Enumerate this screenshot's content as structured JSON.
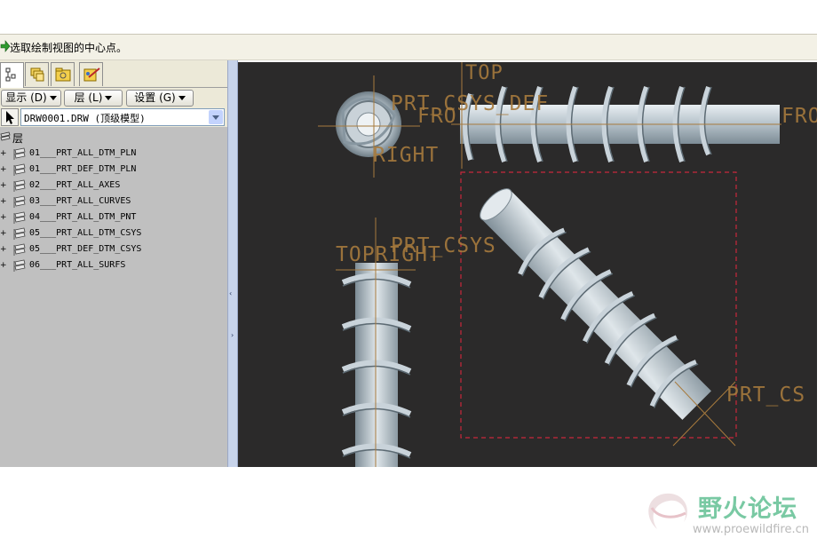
{
  "message_bar": {
    "text": "选取绘制视图的中心点。"
  },
  "left_panel": {
    "tabs": [
      "model-tree-tab",
      "layers-tab",
      "folder-tab",
      "favorites-tab"
    ],
    "menu": {
      "show_label": "显示 (D)",
      "layer_label": "层 (L)",
      "settings_label": "设置 (G)"
    },
    "selector_value": "DRW0001.DRW (顶级模型)",
    "tree_root_label": "层",
    "layers": [
      "01___PRT_ALL_DTM_PLN",
      "01___PRT_DEF_DTM_PLN",
      "02___PRT_ALL_AXES",
      "03___PRT_ALL_CURVES",
      "04___PRT_ALL_DTM_PNT",
      "05___PRT_ALL_DTM_CSYS",
      "05___PRT_DEF_DTM_CSYS",
      "06___PRT_ALL_SURFS"
    ]
  },
  "splitter": {
    "collapse_glyph": "‹",
    "expand_glyph": "›"
  },
  "graphics": {
    "labels": {
      "top1": "TOP",
      "prt_csys_def": "PRT_CSYS_DEF",
      "front1": "FRO",
      "front2": "FRO",
      "right1": "RIGHT",
      "top_right": "TOPRIGHT",
      "prt_csys2": "PRT_CSYS",
      "prt_csys3": "PRT_CS"
    },
    "colors": {
      "background": "#2b2a2a",
      "datum": "#a77a3d",
      "selection_box": "#c8283c",
      "part": "#b8c3cc"
    }
  },
  "watermark": {
    "title": "野火论坛",
    "url": "www.proewildfire.cn"
  }
}
